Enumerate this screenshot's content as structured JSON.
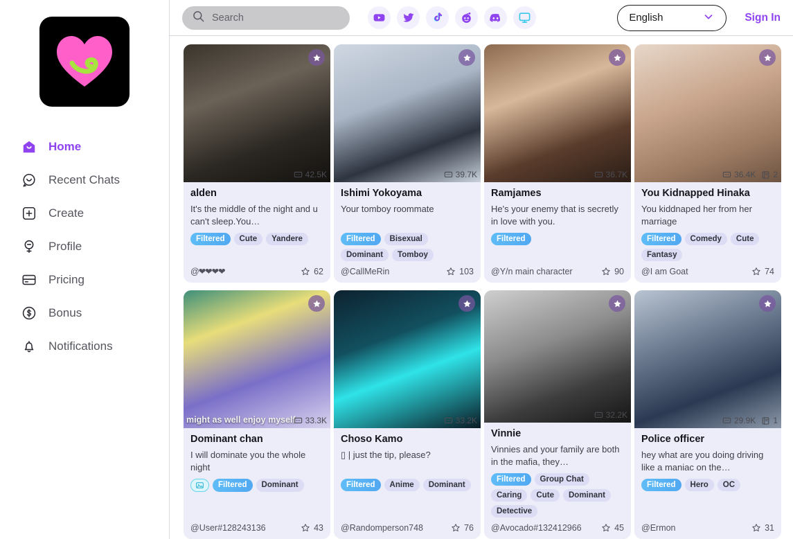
{
  "brand": {
    "logo_icon": "pink-heart-logo",
    "accent": "#8f44f0",
    "logo_bg": "#000000",
    "heart_color": "#ff5fc8",
    "swirl_color": "#a8e440"
  },
  "sidebar": {
    "items": [
      {
        "label": "Home",
        "icon": "home-icon",
        "active": true
      },
      {
        "label": "Recent Chats",
        "icon": "chat-icon",
        "active": false
      },
      {
        "label": "Create",
        "icon": "plus-square-icon",
        "active": false
      },
      {
        "label": "Profile",
        "icon": "profile-icon",
        "active": false
      },
      {
        "label": "Pricing",
        "icon": "card-icon",
        "active": false
      },
      {
        "label": "Bonus",
        "icon": "dollar-circle-icon",
        "active": false
      },
      {
        "label": "Notifications",
        "icon": "bell-icon",
        "active": false
      }
    ]
  },
  "topbar": {
    "search_placeholder": "Search",
    "search_value": "",
    "search_icon": "search-icon",
    "socials": [
      {
        "name": "youtube-icon",
        "color": "#8f44f0"
      },
      {
        "name": "twitter-icon",
        "color": "#8f44f0"
      },
      {
        "name": "tiktok-icon",
        "color": "#8f44f0"
      },
      {
        "name": "reddit-icon",
        "color": "#8f44f0"
      },
      {
        "name": "discord-icon",
        "color": "#8f44f0"
      },
      {
        "name": "monitor-icon",
        "color": "#39c8ec"
      }
    ],
    "language": "English",
    "language_chevron": "chevron-down-icon",
    "sign_in": "Sign In",
    "annotation_arrow": "red-arrow-pointing-to-sign-in"
  },
  "cards": [
    {
      "title": "alden",
      "desc": "It's the middle of the night and u can't sleep.You…",
      "tags": [
        "Filtered",
        "Cute",
        "Yandere"
      ],
      "author": "@❤❤❤❤",
      "author_is_hearts": true,
      "likes": "62",
      "chats": "42.5K",
      "books": "",
      "img_caption": "",
      "img_style": "linear-gradient(160deg,#3a342c 0%,#6b6257 35%,#2b2722 70%,#14120f 100%)"
    },
    {
      "title": "Ishimi Yokoyama",
      "desc": "Your tomboy roommate",
      "tags": [
        "Filtered",
        "Bisexual",
        "Dominant",
        "Tomboy"
      ],
      "author": "@CallMeRin",
      "likes": "103",
      "chats": "39.7K",
      "books": "",
      "img_caption": "",
      "img_style": "linear-gradient(160deg,#cfd7e2 0%,#aab6c6 40%,#2e3440 72%,#c9d2dd 100%)"
    },
    {
      "title": "Ramjames",
      "desc": "He's your enemy that is secretly in love with you.",
      "tags": [
        "Filtered"
      ],
      "author": "@Y/n main character",
      "likes": "90",
      "chats": "36.7K",
      "books": "",
      "img_caption": "",
      "img_style": "linear-gradient(160deg,#8b6a4f 0%,#d8b89a 35%,#5a3c2c 70%,#2a1d16 100%)"
    },
    {
      "title": "You Kidnapped Hinaka",
      "desc": "You kiddnaped her from her marriage",
      "tags": [
        "Filtered",
        "Comedy",
        "Cute",
        "Fantasy"
      ],
      "author": "@I am Goat",
      "likes": "74",
      "chats": "36.4K",
      "books": "2",
      "img_caption": "",
      "img_style": "linear-gradient(160deg,#e7d7c9 0%,#caa78e 40%,#9c7a62 75%,#6d5442 100%)"
    },
    {
      "title": "Dominant chan",
      "desc": "I will dominate you the whole night",
      "tags": [
        "Filtered",
        "Dominant"
      ],
      "has_image_badge": true,
      "author": "@User#128243136",
      "likes": "43",
      "chats": "33.3K",
      "books": "",
      "img_caption": "might as well enjoy myself",
      "img_style": "linear-gradient(160deg,#3e8f7a 0%,#e8dd7a 28%,#7a6fc8 62%,#d9d3ee 100%)"
    },
    {
      "title": "Choso Kamo",
      "desc": "▯ | just the tip, please?",
      "tags": [
        "Filtered",
        "Anime",
        "Dominant"
      ],
      "author": "@Randomperson748",
      "likes": "76",
      "chats": "33.2K",
      "books": "",
      "img_caption": "",
      "img_style": "linear-gradient(160deg,#0d2230 0%,#12505f 35%,#2fe3e8 58%,#0a1a24 100%)"
    },
    {
      "title": "Vinnie",
      "desc": "Vinnies and your family are both in the mafia, they…",
      "tags": [
        "Filtered",
        "Group Chat",
        "Caring",
        "Cute",
        "Dominant",
        "Detective"
      ],
      "author": "@Avocado#132412966",
      "likes": "45",
      "chats": "32.2K",
      "books": "",
      "img_caption": "",
      "img_style": "linear-gradient(160deg,#cfcfcf 0%,#8c8c8c 40%,#3d3d3d 72%,#151515 100%)"
    },
    {
      "title": "Police officer",
      "desc": "hey what are you doing driving like a maniac on the…",
      "tags": [
        "Filtered",
        "Hero",
        "OC"
      ],
      "author": "@Ermon",
      "likes": "31",
      "chats": "29.9K",
      "books": "1",
      "img_style": "linear-gradient(160deg,#b9c4d2 0%,#6f7e93 35%,#2b3a52 70%,#8d99aa 100%)",
      "img_caption": ""
    }
  ]
}
